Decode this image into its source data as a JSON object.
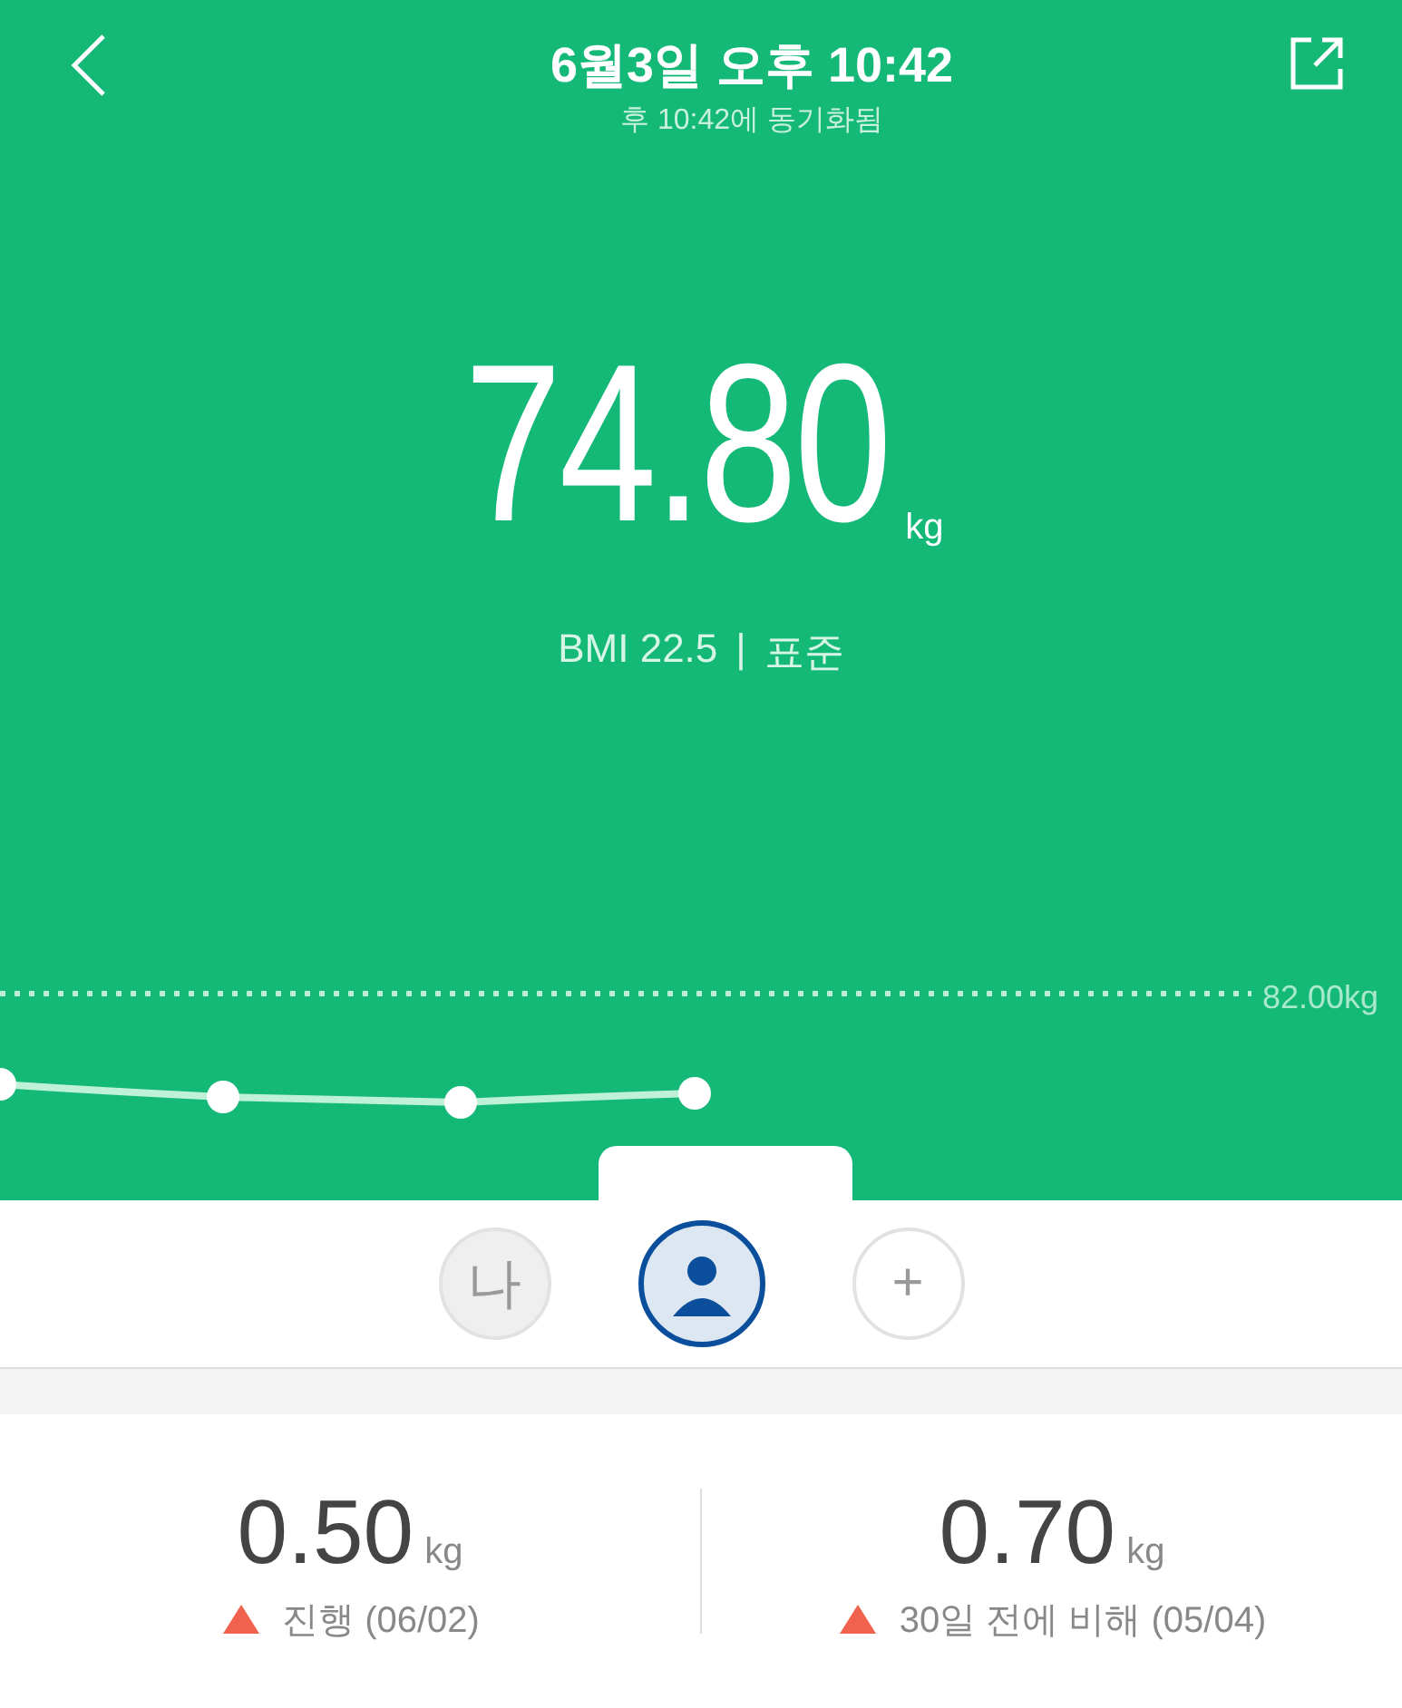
{
  "header": {
    "title": "6월3일 오후 10:42",
    "subtitle": "후 10:42에 동기화됨"
  },
  "weight": {
    "value": "74.80",
    "unit": "kg",
    "bmi": "BMI 22.5",
    "separator": "|",
    "status": "표준"
  },
  "trend": {
    "target_label": "82.00kg"
  },
  "users": [
    {
      "kind": "initial",
      "label": "나",
      "selected": false
    },
    {
      "kind": "avatar",
      "selected": true
    },
    {
      "kind": "add",
      "label": "+",
      "selected": false
    }
  ],
  "stats": [
    {
      "value": "0.50",
      "unit": "kg",
      "kind": "increase",
      "caption": "진행 (06/02)"
    },
    {
      "value": "0.70",
      "unit": "kg",
      "kind": "increase",
      "caption": "30일 전에 비해 (05/04)"
    }
  ]
}
